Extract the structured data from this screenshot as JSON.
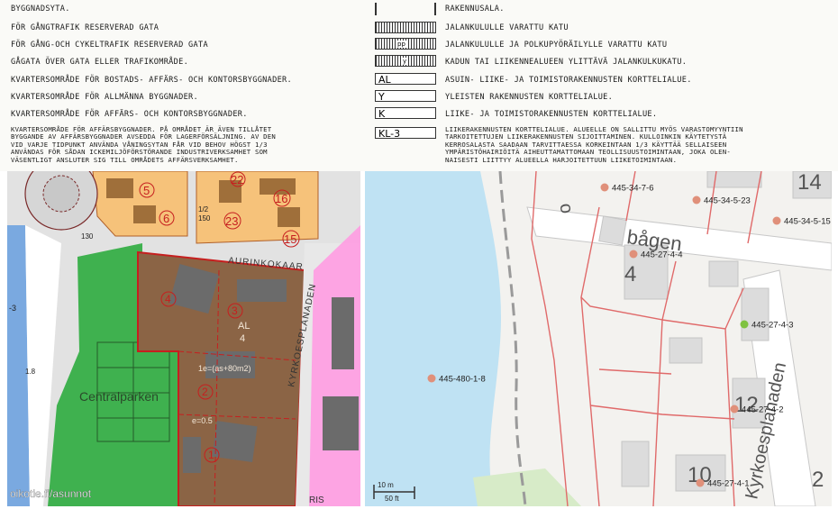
{
  "legend": {
    "rows": [
      {
        "left": "BYGGNADSYTA.",
        "symbol": "",
        "right": "RAKENNUSALA."
      },
      {
        "left": "FÖR GÅNGTRAFIK RESERVERAD GATA",
        "symbol": "",
        "right": "JALANKULULLE VARATTU KATU"
      },
      {
        "left": "FÖR GÅNG-OCH CYKELTRAFIK RESERVERAD GATA",
        "symbol": "pp",
        "right": "JALANKULULLE JA POLKUPYÖRÄILYLLE VARATTU KATU"
      },
      {
        "left": "GÅGATA ÖVER GATA ELLER TRAFIKOMRÅDE.",
        "symbol": "y",
        "right": "KADUN TAI LIIKENNEALUEEN YLITTÄVÄ JALANKULKUKATU."
      },
      {
        "left": "KVARTERSOMRÅDE FÖR BOSTADS- AFFÄRS- OCH KONTORSBYGGNADER.",
        "symbol": "AL",
        "right": "ASUIN- LIIKE- JA TOIMISTORAKENNUSTEN KORTTELIALUE."
      },
      {
        "left": "KVARTERSOMRÅDE FÖR ALLMÄNNA BYGGNADER.",
        "symbol": "Y",
        "right": "YLEISTEN RAKENNUSTEN KORTTELIALUE."
      },
      {
        "left": "KVARTERSOMRÅDE FÖR AFFÄRS- OCH KONTORSBYGGNADER.",
        "symbol": "K",
        "right": "LIIKE- JA TOIMISTORAKENNUSTEN KORTTELIALUE."
      }
    ],
    "kl_symbol": "KL-3",
    "kl_left": "KVARTERSOMRÅDE FÖR AFFÄRSBYGGNADER. PÅ OMRÅDET ÄR ÄVEN TILLÅTET\nBYGGANDE AV AFFÄRSBYGGNADER AVSEDDA FÖR LAGERFÖRSÄLJNING. AV DEN\nVID VARJE TIDPUNKT ANVÄNDA VÅNINGSYTAN FÅR VID BEHOV HÖGST 1/3\nANVÄNDAS FÖR SÅDAN ICKEMILJÖFÖRSTÖRANDE INDUSTRIVERKSAMHET SOM\nVÄSENTLIGT ANSLUTER SIG TILL OMRÅDETS AFFÄRSVERKSAMHET.",
    "kl_right": "LIIKERAKENNUSTEN KORTTELIALUE. ALUEELLE ON SALLITTU MYÖS VARASTOMYYNTIIN\nTARKOITETTUJEN LIIKERAKENNUSTEN SIJOITTAMINEN. KULLOINKIN KÄYTETYSTÄ\nKERROSALASTA SAADAAN TARVITTAESSA KORKEINTAAN 1/3 KÄYTTÄÄ SELLAISEEN\nYMPÄRISTÖHAIRIÖITÄ AIHEUTTAMATTOMAAN TEOLLISUUSTOIMINTAAN, JOKA OLEN-\nNAISESTI LIITTYY ALUEELLA HARJOITETTUUN LIIKETOIMINTAAN."
  },
  "plan_map": {
    "street_label": "AURINKOKAAR",
    "street_label_2": "KYRKOESPLANADEN",
    "street_bottom": "RIS",
    "park_label": "Centralparken",
    "quarter_code": "AL",
    "quarter_number": "4",
    "floor_area": "1e=(as+80m2)",
    "efficiency": "e=0.5",
    "lot_numbers": [
      "1",
      "2",
      "3",
      "4"
    ],
    "block_numbers": [
      "5",
      "6",
      "22",
      "23",
      "16",
      "15"
    ],
    "misc_labels": [
      "1.8",
      "-3",
      "130",
      "1/2",
      "150"
    ],
    "watermark": "oikotie.fi/asunnot"
  },
  "cadastral_map": {
    "street_label_1": "bågen",
    "street_label_2": "Kyrkoesplanaden",
    "block_numbers": [
      "4",
      "12",
      "10",
      "14",
      "2"
    ],
    "parcels": [
      {
        "id": "445-34-7-6",
        "color": "#e0907a"
      },
      {
        "id": "445-34-5-23",
        "color": "#e0907a"
      },
      {
        "id": "445-34-5-15",
        "color": "#e0907a"
      },
      {
        "id": "445-27-4-4",
        "color": "#e0907a"
      },
      {
        "id": "445-27-4-3",
        "color": "#7fc241"
      },
      {
        "id": "445-480-1-8",
        "color": "#e0907a"
      },
      {
        "id": "445-27-4-2",
        "color": "#e0907a"
      },
      {
        "id": "445-27-4-1",
        "color": "#e0907a"
      }
    ],
    "scale_m": "10 m",
    "scale_ft": "50 ft",
    "colors": {
      "water": "#bfe2f3",
      "parcel_line": "#e06a6a",
      "building": "#dcdcdc"
    }
  }
}
